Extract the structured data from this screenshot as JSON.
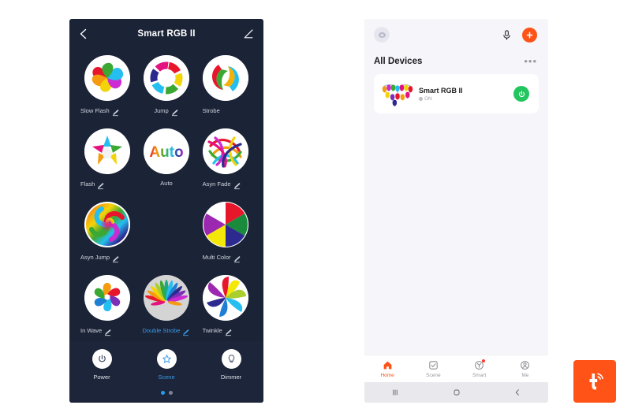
{
  "left_phone": {
    "header": {
      "title": "Smart RGB II",
      "back_icon": "chevron-left-icon",
      "edit_icon": "pencil-edit-icon"
    },
    "effects": [
      {
        "label": "Slow Flash",
        "icon": "pinwheel-swirl-icon",
        "editable": true,
        "selected": false
      },
      {
        "label": "Jump",
        "icon": "segmented-ring-icon",
        "editable": true,
        "selected": false
      },
      {
        "label": "Strobe",
        "icon": "double-spiral-icon",
        "editable": false,
        "selected": false
      },
      {
        "label": "Flash",
        "icon": "color-star-icon",
        "editable": true,
        "selected": false
      },
      {
        "label": "Auto",
        "icon": "auto-rainbow-text-icon",
        "editable": false,
        "selected": false
      },
      {
        "label": "Asyn Fade",
        "icon": "tangled-ribbons-icon",
        "editable": true,
        "selected": false
      },
      {
        "label": "Asyn Jump",
        "icon": "rainbow-spiral-icon",
        "editable": true,
        "selected": false
      },
      {
        "label": "Multi Color",
        "icon": "six-segment-wheel-icon",
        "editable": true,
        "selected": false
      },
      {
        "label": "In Wave",
        "icon": "teardrop-swirl-icon",
        "editable": true,
        "selected": false
      },
      {
        "label": "Double Strobe",
        "icon": "radiating-petals-icon",
        "editable": true,
        "selected": true
      },
      {
        "label": "Twinkle",
        "icon": "color-wheel-icon",
        "editable": true,
        "selected": false
      }
    ],
    "auto_text": "Auto",
    "controls": [
      {
        "label": "Power",
        "icon": "power-icon",
        "active": false
      },
      {
        "label": "Scene",
        "icon": "star-icon",
        "active": true
      },
      {
        "label": "Dimmer",
        "icon": "bulb-icon",
        "active": false
      }
    ],
    "pagination": {
      "total": 2,
      "active_index": 0
    },
    "colors": {
      "background": "#1b2336",
      "accent": "#3b9ae8",
      "label": "#d3d6de"
    }
  },
  "right_phone": {
    "topbar": {
      "avatar_icon": "user-avatar-icon",
      "mic_icon": "microphone-icon",
      "add_icon": "plus-icon"
    },
    "section": {
      "title": "All Devices",
      "more_icon": "ellipsis-icon",
      "more_label": "•••"
    },
    "device": {
      "name": "Smart RGB II",
      "status": "ON",
      "icon": "string-lights-icon",
      "power_icon": "power-icon",
      "power_color": "#22c55e"
    },
    "tabs": [
      {
        "label": "Home",
        "icon": "home-icon",
        "active": true,
        "badge": false
      },
      {
        "label": "Scene",
        "icon": "checkbox-icon",
        "active": false,
        "badge": false
      },
      {
        "label": "Smart",
        "icon": "smart-automation-icon",
        "active": false,
        "badge": true
      },
      {
        "label": "Me",
        "icon": "person-circle-icon",
        "active": false,
        "badge": false
      }
    ],
    "nav": [
      {
        "icon": "recents-icon"
      },
      {
        "icon": "home-square-icon"
      },
      {
        "icon": "back-chevron-icon"
      }
    ],
    "colors": {
      "background": "#f6f6fa",
      "accent": "#ff5317",
      "card": "#ffffff"
    }
  },
  "branding": {
    "logo_icon": "tuya-logo-icon",
    "logo_color": "#ff5317"
  }
}
